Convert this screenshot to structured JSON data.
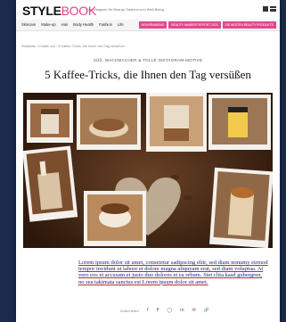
{
  "header": {
    "logo_bold": "STYLE",
    "logo_light": "BOOK",
    "tagline": "Das Magazin für Beauty, Fashion und Well-Being"
  },
  "nav": {
    "items": [
      "Skincare",
      "Make-up",
      "Hair",
      "Body Health",
      "Fashion",
      "Life"
    ],
    "pills": [
      "NEWSRANKING",
      "BEAUTY AWARDS REPORT 2023",
      "DIE BESTEN BEAUTY PRODUKTE"
    ]
  },
  "breadcrumb": "Startseite › Inhalte von › 5 Kaffee-Tricks, die Ihnen den Tag versüßen",
  "article": {
    "kicker": "SÜß, WACHMACHER & TOLLE INSTAGRAM-MOTIVE",
    "title": "5 Kaffee-Tricks, die Ihnen den Tag versüßen",
    "body": "Lorem ipsum dolor sit amet, consetetur sadipscing elitr, sed diam nonumy eirmod tempor invidunt ut labore et dolore magna aliquyam erat, sed diam voluptua. At vero eos et accusam et justo duo dolores et ea rebum. Stet clita kasd gubergren, no sea takimata sanctus est Lorem ipsum dolor sit amet."
  },
  "share": {
    "label": "Artikel teilen",
    "icons": [
      "facebook-icon",
      "pinterest-icon",
      "whatsapp-icon",
      "linkedin-icon",
      "email-icon",
      "link-icon"
    ]
  },
  "colors": {
    "accent": "#e83e8c",
    "background": "#1b2a4d",
    "link_text": "#1a237e"
  }
}
